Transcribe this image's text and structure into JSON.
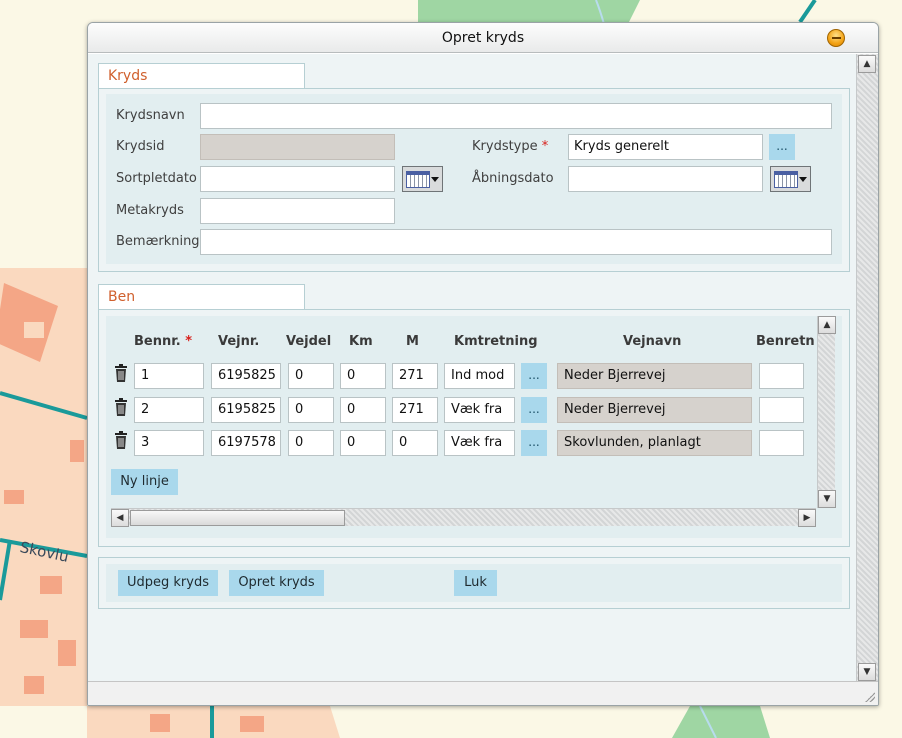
{
  "dialog": {
    "title": "Opret kryds"
  },
  "kryds": {
    "tab_label": "Kryds",
    "krydsnavn_label": "Krydsnavn",
    "krydsnavn_value": "",
    "krydsid_label": "Krydsid",
    "krydsid_value": "",
    "krydstype_label": "Krydstype",
    "required_mark": "*",
    "krydstype_value": "Kryds generelt",
    "dots_label": "...",
    "sortpletdato_label": "Sortpletdato",
    "sortpletdato_value": "",
    "abningsdato_label": "Åbningsdato",
    "abningsdato_value": "",
    "metakryds_label": "Metakryds",
    "metakryds_value": "",
    "bemaerkning_label": "Bemærkning",
    "bemaerkning_value": ""
  },
  "ben": {
    "tab_label": "Ben",
    "columns": {
      "bennr": "Bennr.",
      "vejnr": "Vejnr.",
      "vejdel": "Vejdel",
      "km": "Km",
      "m": "M",
      "kmretning": "Kmtretning",
      "vejnavn": "Vejnavn",
      "benretning": "Benretn"
    },
    "rows": [
      {
        "bennr": "1",
        "vejnr": "6195825",
        "vejdel": "0",
        "km": "0",
        "m": "271",
        "kmretning": "Ind mod",
        "dots": "...",
        "vejnavn": "Neder Bjerrevej",
        "benretning": ""
      },
      {
        "bennr": "2",
        "vejnr": "6195825",
        "vejdel": "0",
        "km": "0",
        "m": "271",
        "kmretning": "Væk fra",
        "dots": "...",
        "vejnavn": "Neder Bjerrevej",
        "benretning": ""
      },
      {
        "bennr": "3",
        "vejnr": "6197578",
        "vejdel": "0",
        "km": "0",
        "m": "0",
        "kmretning": "Væk fra",
        "dots": "...",
        "vejnavn": "Skovlunden, planlagt",
        "benretning": ""
      }
    ],
    "new_row_label": "Ny linje"
  },
  "actions": {
    "udpeg_label": "Udpeg kryds",
    "opret_label": "Opret kryds",
    "luk_label": "Luk"
  },
  "map": {
    "road_label": "Skovlu"
  },
  "colors": {
    "tab_text": "#d0602d",
    "button_bg": "#a9d8ec",
    "readonly_bg": "#d6d2cd",
    "required": "#d8201c"
  }
}
